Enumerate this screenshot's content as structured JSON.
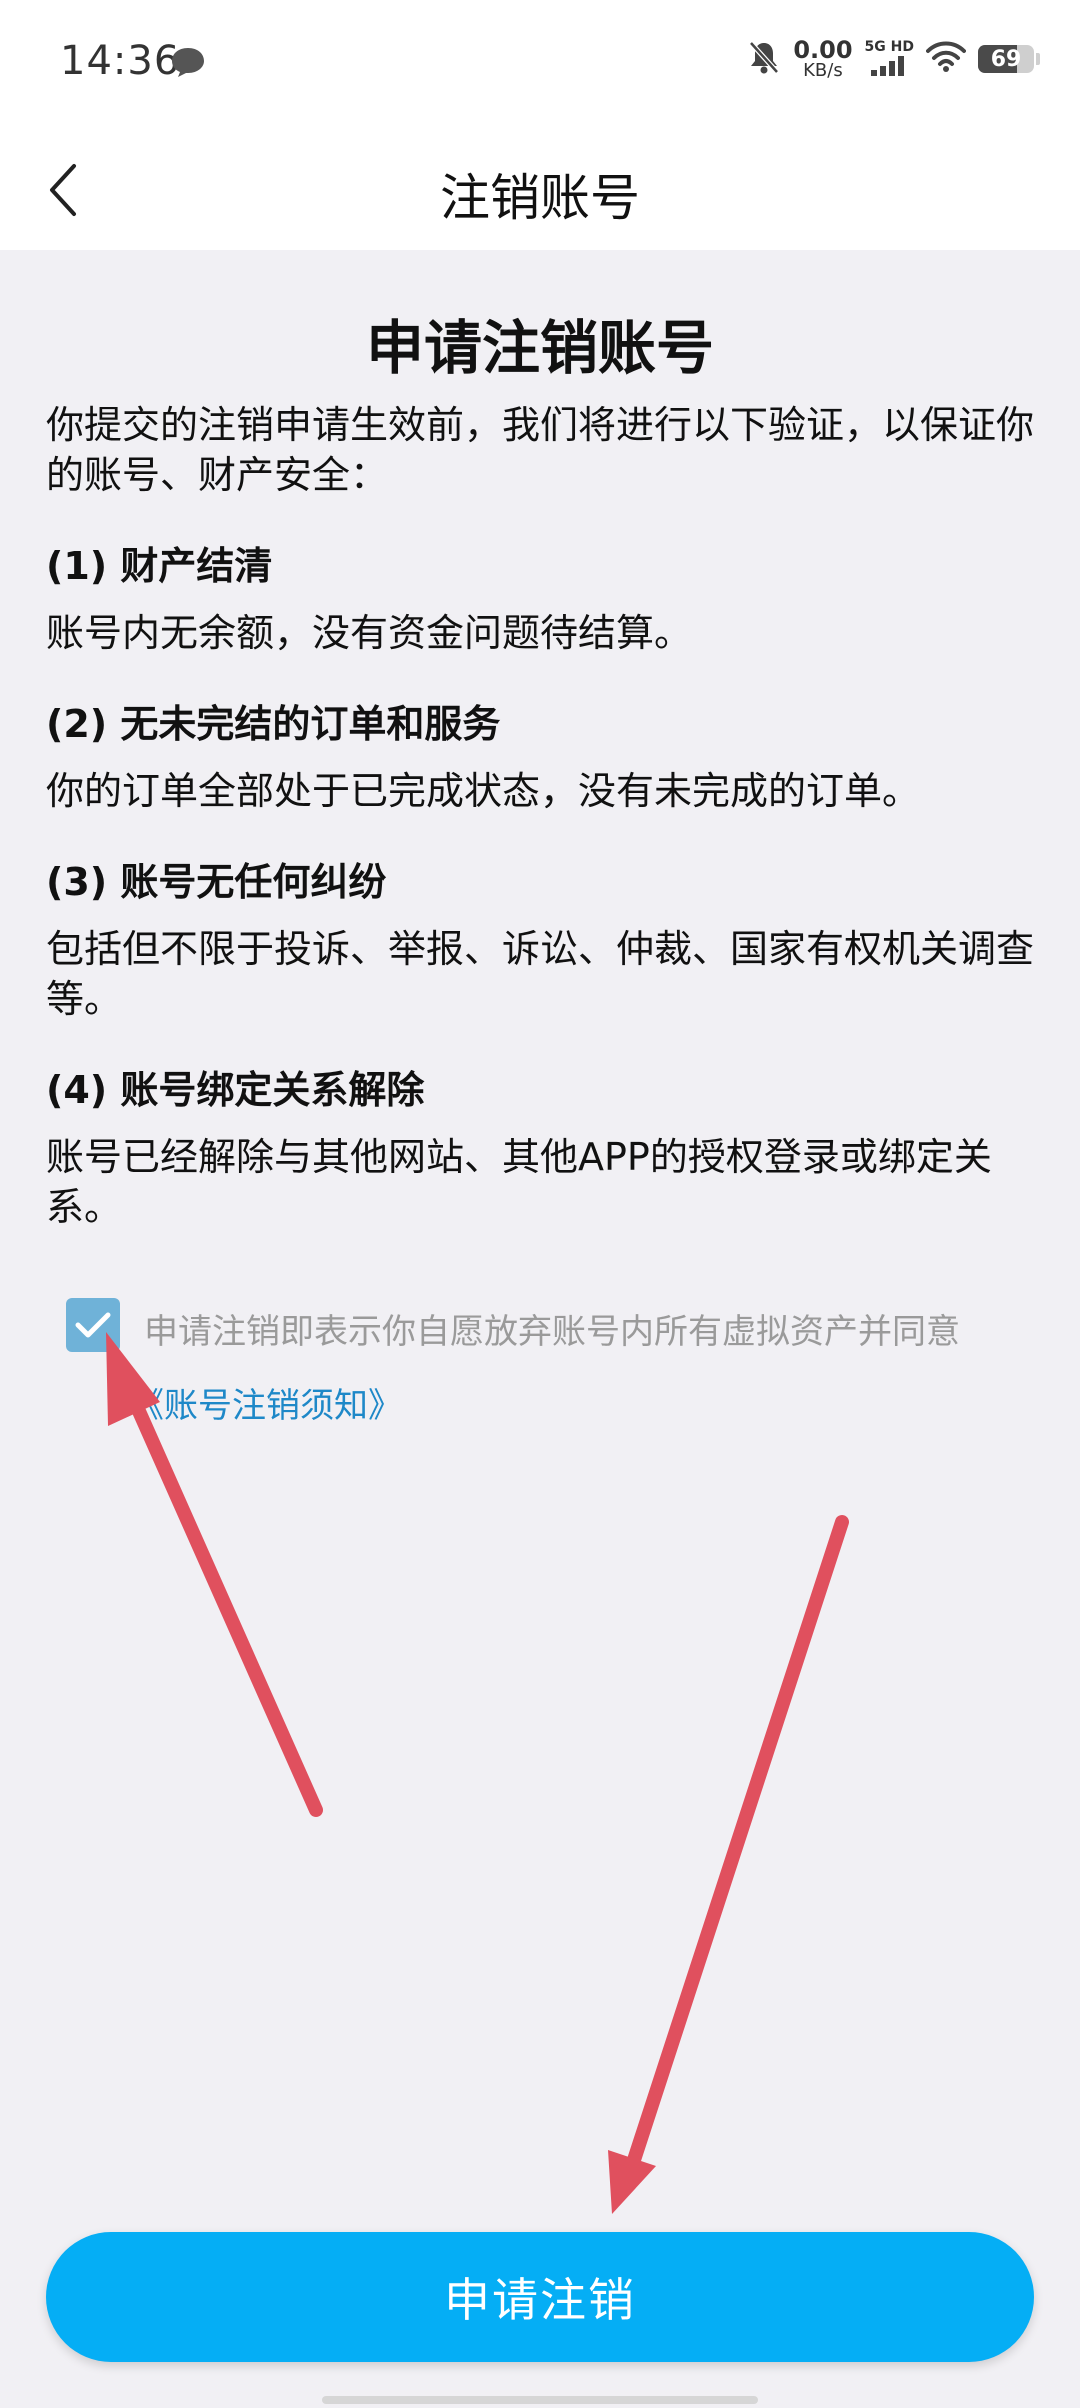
{
  "status_bar": {
    "time": "14:36",
    "net_speed_value": "0.00",
    "net_speed_unit": "KB/s",
    "net_type_top": "5G",
    "net_type_side": "HD",
    "battery_level": "69",
    "battery_percent": 69
  },
  "nav": {
    "title": "注销账号"
  },
  "main": {
    "heading": "申请注销账号",
    "intro": "你提交的注销申请生效前，我们将进行以下验证，以保证你的账号、财产安全：",
    "sections": [
      {
        "title": "(1) 财产结清",
        "body": "账号内无余额，没有资金问题待结算。"
      },
      {
        "title": "(2) 无未完结的订单和服务",
        "body": "你的订单全部处于已完成状态，没有未完成的订单。"
      },
      {
        "title": "(3) 账号无任何纠纷",
        "body": "包括但不限于投诉、举报、诉讼、仲裁、国家有权机关调查等。"
      },
      {
        "title": "(4) 账号绑定关系解除",
        "body": "账号已经解除与其他网站、其他APP的授权登录或绑定关系。"
      }
    ]
  },
  "agreement": {
    "checked": true,
    "text": "申请注销即表示你自愿放弃账号内所有虚拟资产并同意",
    "link": "《账号注销须知》"
  },
  "submit": {
    "label": "申请注销"
  },
  "colors": {
    "accent": "#05aef5",
    "link": "#1e88c8",
    "checkbox": "#6fb2d8",
    "annotation_arrow": "#e0505e"
  }
}
